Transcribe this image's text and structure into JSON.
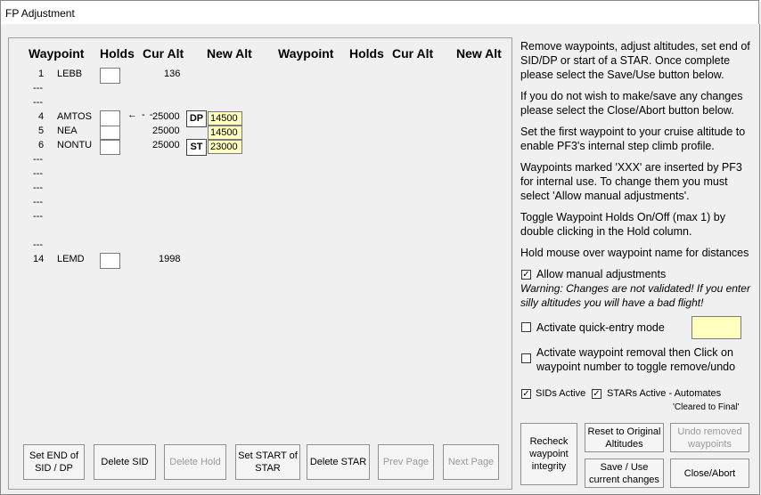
{
  "window": {
    "title": "FP Adjustment"
  },
  "headers": {
    "waypoint": "Waypoint",
    "holds": "Holds",
    "cur_alt": "Cur Alt",
    "new_alt": "New Alt"
  },
  "rows": [
    {
      "num": "1",
      "name": "LEBB",
      "cur_alt": "136"
    },
    {
      "num": "---"
    },
    {
      "num": "---"
    },
    {
      "num": "4",
      "name": "AMTOS",
      "cur_alt": "25000",
      "tag": "DP",
      "new_alt": "14500"
    },
    {
      "num": "5",
      "name": "NEA",
      "cur_alt": "25000",
      "new_alt": "14500"
    },
    {
      "num": "6",
      "name": "NONTU",
      "cur_alt": "25000",
      "tag": "ST",
      "new_alt": "23000"
    },
    {
      "num": "---"
    },
    {
      "num": "---"
    },
    {
      "num": "---"
    },
    {
      "num": "---"
    },
    {
      "num": "---"
    },
    {
      "num": "---"
    },
    {
      "num": "14",
      "name": "LEMD",
      "cur_alt": "1998"
    }
  ],
  "arrow": "← - -",
  "buttons": {
    "set_end_sid": "Set END of SID / DP",
    "delete_sid": "Delete SID",
    "delete_hold": "Delete Hold",
    "set_start_star": "Set START of STAR",
    "delete_star": "Delete STAR",
    "prev_page": "Prev Page",
    "next_page": "Next Page",
    "recheck": "Recheck waypoint integrity",
    "reset": "Reset to Original Altitudes",
    "undo": "Undo removed waypoints",
    "save": "Save / Use current changes",
    "close": "Close/Abort"
  },
  "instructions": {
    "p1": "Remove waypoints, adjust altitudes, set end of SID/DP or start of a STAR. Once complete please select the Save/Use button below.",
    "p2": "If you do not wish to make/save any changes please select the Close/Abort button below.",
    "p3": "Set the first waypoint to your cruise altitude to enable PF3's internal step climb profile.",
    "p4": "Waypoints marked 'XXX' are inserted by PF3 for internal use. To change them you must select 'Allow manual adjustments'.",
    "p5": "Toggle Waypoint Holds On/Off (max 1) by double clicking in the Hold column.",
    "p6": "Hold mouse over waypoint name for distances"
  },
  "options": {
    "allow_manual": {
      "label": "Allow manual adjustments",
      "checked": true
    },
    "warning": "Warning: Changes are not validated! If you enter silly altitudes you will have a bad flight!",
    "quick_entry": {
      "label": "Activate quick-entry mode",
      "checked": false,
      "value": ""
    },
    "removal": {
      "label": "Activate waypoint removal then Click on waypoint number to toggle remove/undo",
      "checked": false
    },
    "sids_active": {
      "label": "SIDs Active",
      "checked": true
    },
    "stars_active": {
      "label": "STARs Active - Automates",
      "checked": true
    },
    "stars_note": "'Cleared to Final'"
  }
}
